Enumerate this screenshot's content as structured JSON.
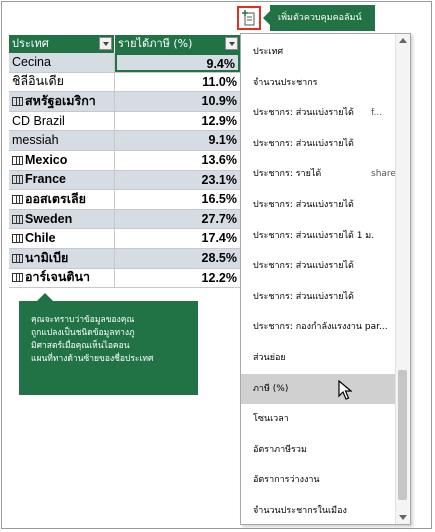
{
  "table": {
    "headers": [
      "ประเทศ",
      "รายได้ภาษี (%)"
    ],
    "rows": [
      {
        "country": "Cecina",
        "value": "9.4%",
        "geo": false,
        "alt": true,
        "selected": true
      },
      {
        "country": "ชิลีอินเดีย",
        "value": "11.0%",
        "geo": false,
        "alt": false,
        "selected": false
      },
      {
        "country": "สหรัฐอเมริกา",
        "value": "10.9%",
        "geo": true,
        "alt": true,
        "selected": false
      },
      {
        "country": "CD Brazil",
        "value": "12.9%",
        "geo": false,
        "alt": false,
        "selected": false
      },
      {
        "country": "messiah",
        "value": "9.1%",
        "geo": false,
        "alt": true,
        "selected": false
      },
      {
        "country": "Mexico",
        "value": "13.6%",
        "geo": true,
        "alt": false,
        "selected": false
      },
      {
        "country": "France",
        "value": "23.1%",
        "geo": true,
        "alt": true,
        "selected": false
      },
      {
        "country": "ออสเตรเลีย",
        "value": "16.5%",
        "geo": true,
        "alt": false,
        "selected": false
      },
      {
        "country": "Sweden",
        "value": "27.7%",
        "geo": true,
        "alt": true,
        "selected": false
      },
      {
        "country": "Chile",
        "value": "17.4%",
        "geo": true,
        "alt": false,
        "selected": false
      },
      {
        "country": "นามิเบีย",
        "value": "28.5%",
        "geo": true,
        "alt": true,
        "selected": false
      },
      {
        "country": "อาร์เจนตินา",
        "value": "12.2%",
        "geo": true,
        "alt": false,
        "selected": false
      }
    ]
  },
  "tooltip": {
    "lines": [
      "คุณจะทราบว่าข้อมูลของคุณ",
      "ถูกแปลงเป็นชนิดข้อมูลทางภู",
      "มิศาสตร์เมื่อคุณเห็นไอคอน",
      "แผนที่ทางด้านซ้ายของชื่อประเทศ"
    ]
  },
  "add_column": {
    "label": "เพิ่มตัวควบคุมคอลัมน์",
    "icon": "add-column-icon"
  },
  "field_list": {
    "items": [
      {
        "label": "ประเทศ",
        "suffix": ""
      },
      {
        "label": "จำนวนประชากร",
        "suffix": ""
      },
      {
        "label": "ประชากร: ส่วนแบ่งรายได้",
        "suffix": "f..."
      },
      {
        "label": "ประชากร: ส่วนแบ่งรายได้",
        "suffix": ""
      },
      {
        "label": "ประชากร: รายได้",
        "suffix": "share..."
      },
      {
        "label": "ประชากร: ส่วนแบ่งรายได้",
        "suffix": ""
      },
      {
        "label": "ประชากร: ส่วนแบ่งรายได้ 1 ม.",
        "suffix": ""
      },
      {
        "label": "ประชากร: ส่วนแบ่งรายได้",
        "suffix": ""
      },
      {
        "label": "ประชากร: ส่วนแบ่งรายได้",
        "suffix": ""
      },
      {
        "label": "ประชากร: กองกำลังแรงงาน par...",
        "suffix": ""
      },
      {
        "label": "ส่วนย่อย",
        "suffix": ""
      },
      {
        "label": "ภาษี (%)",
        "suffix": ""
      },
      {
        "label": "โซนเวลา",
        "suffix": ""
      },
      {
        "label": "อัตราภาษีรวม",
        "suffix": ""
      },
      {
        "label": "อัตราการว่างงาน",
        "suffix": ""
      },
      {
        "label": "จำนวนประชากรในเมือง",
        "suffix": ""
      }
    ],
    "highlighted_index": 11
  },
  "colors": {
    "accent": "#217346",
    "band": "#d6dce4",
    "highlight": "#d0d0d0",
    "add_border": "#e03020"
  }
}
